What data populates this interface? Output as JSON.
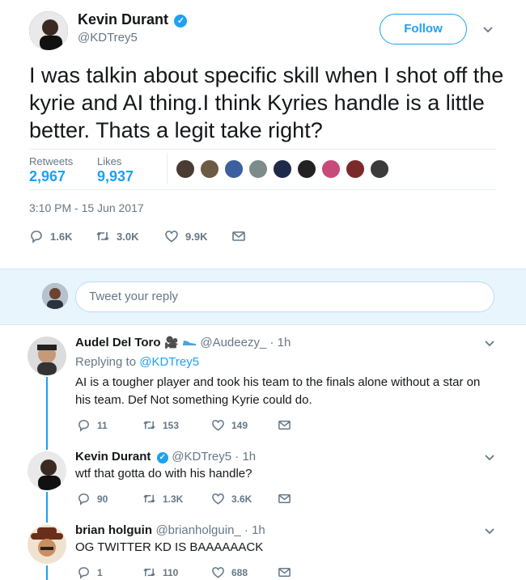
{
  "tweet": {
    "author_name": "Kevin Durant",
    "handle": "@KDTrey5",
    "follow_label": "Follow",
    "text": "I was talkin about specific skill when I shot off the kyrie and AI thing.I think Kyries handle is a little better. Thats a legit take right?",
    "retweets_label": "Retweets",
    "retweets_value": "2,967",
    "likes_label": "Likes",
    "likes_value": "9,937",
    "timestamp": "3:10 PM - 15 Jun 2017",
    "actions": {
      "replies": "1.6K",
      "retweets": "3.0K",
      "likes": "9.9K"
    }
  },
  "liker_avatar_colors": [
    "#4a3c33",
    "#6b5a45",
    "#3b5fa0",
    "#7d8b8a",
    "#1f2a4a",
    "#222222",
    "#c74a7a",
    "#7a2a2a",
    "#3b3b3b"
  ],
  "reply_box": {
    "placeholder": "Tweet your reply"
  },
  "replies": [
    {
      "name": "Audel Del Toro",
      "emoji": "🎥",
      "handle_time": "@Audeezy_ · 1h",
      "replying_prefix": "Replying to ",
      "replying_to": "@KDTrey5",
      "text": "AI is a tougher player and took his team to the finals alone without a star on his team. Def Not something Kyrie could do.",
      "replies": "11",
      "retweets": "153",
      "likes": "149"
    },
    {
      "name": "Kevin Durant",
      "handle_time": "@KDTrey5 · 1h",
      "text": "wtf that gotta do with his handle?",
      "replies": "90",
      "retweets": "1.3K",
      "likes": "3.6K"
    },
    {
      "name": "brian holguin",
      "handle_time": "@brianholguin_ · 1h",
      "text": "OG TWITTER KD IS BAAAAAACK",
      "replies": "1",
      "retweets": "110",
      "likes": "688"
    }
  ],
  "colors": {
    "accent": "#1da1f2",
    "muted": "#657786",
    "reply_bar_bg": "#e8f5fd"
  }
}
